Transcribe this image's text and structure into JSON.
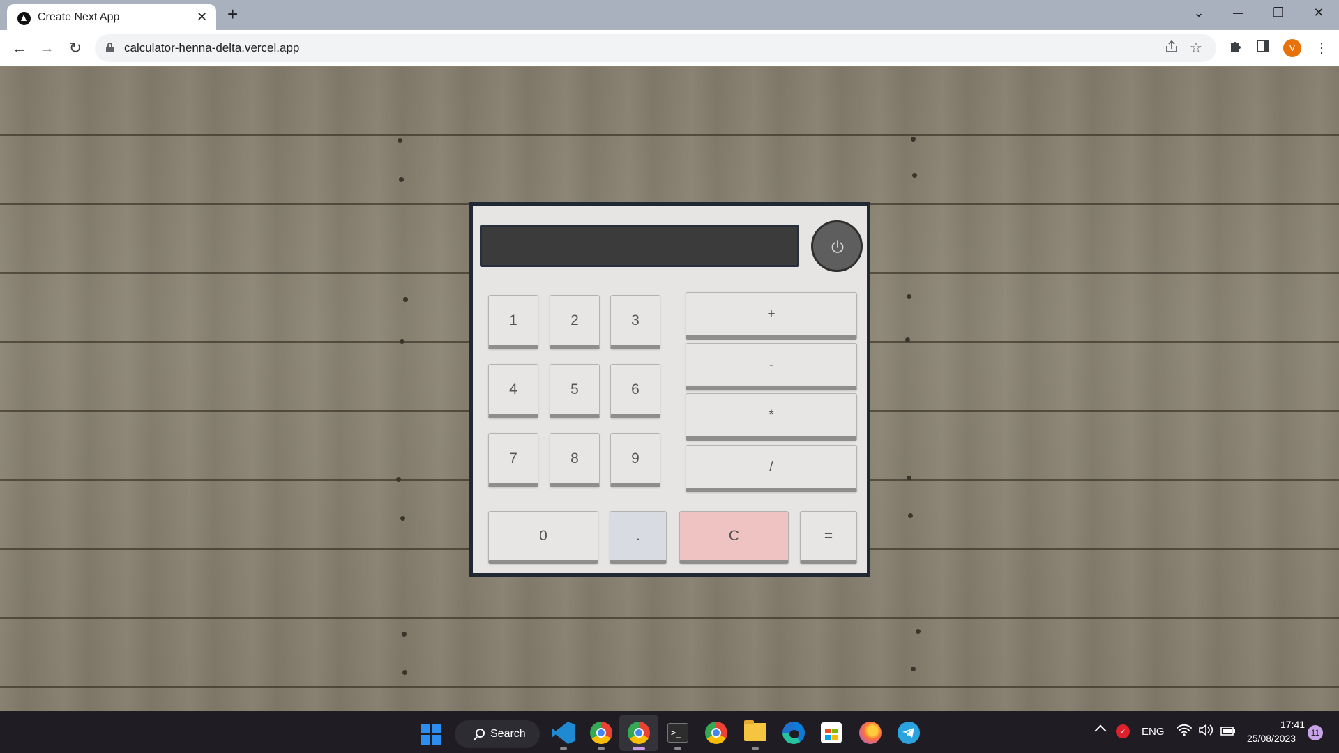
{
  "browser": {
    "tab_title": "Create Next App",
    "tab_close": "✕",
    "new_tab": "+",
    "url": "calculator-henna-delta.vercel.app",
    "profile_initial": "V",
    "window_controls": {
      "dropdown": "⌄",
      "minimize": "—",
      "restore": "❐",
      "close": "✕"
    },
    "nav": {
      "back": "←",
      "forward": "→",
      "reload": "↻"
    }
  },
  "calculator": {
    "display_value": "",
    "digit_rows": [
      [
        "1",
        "2",
        "3"
      ],
      [
        "4",
        "5",
        "6"
      ],
      [
        "7",
        "8",
        "9"
      ]
    ],
    "operators": [
      "+",
      "-",
      "*",
      "/"
    ],
    "bottom": {
      "zero": "0",
      "dot": ".",
      "clear": "C",
      "equals": "="
    }
  },
  "taskbar": {
    "search_label": "Search",
    "language": "ENG",
    "time": "17:41",
    "date": "25/08/2023",
    "notification_count": "11"
  },
  "colors": {
    "taskbar_bg": "#1f1d23",
    "clear_button": "#f0c3c3",
    "display_bg": "#3b3b3b",
    "calculator_frame": "#202833"
  }
}
